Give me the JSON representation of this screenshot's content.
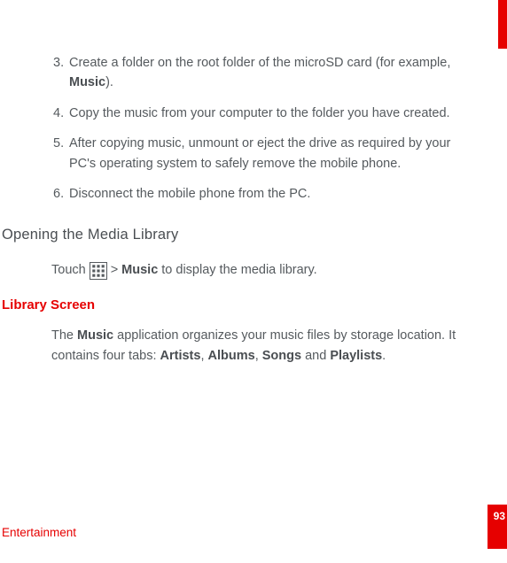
{
  "steps": [
    {
      "num": "3.",
      "pre": "Create a folder on the root folder of the microSD card (for example, ",
      "bold": "Music",
      "post": ")."
    },
    {
      "num": "4.",
      "pre": "Copy the music from your computer to the folder you have created.",
      "bold": "",
      "post": ""
    },
    {
      "num": "5.",
      "pre": "After copying music, unmount or eject the drive as required by your PC's operating system to safely remove the mobile phone.",
      "bold": "",
      "post": ""
    },
    {
      "num": "6.",
      "pre": "Disconnect the mobile phone from the PC.",
      "bold": "",
      "post": ""
    }
  ],
  "heading_opening": "Opening the Media Library",
  "touch_line": {
    "pre": "Touch",
    "icon_name": "apps-grid-icon",
    "gt": ">",
    "bold": "Music",
    "post": "to display the media library."
  },
  "library_heading": "Library Screen",
  "library_para": {
    "t1": "The ",
    "b1": "Music",
    "t2": " application organizes your music files by storage location. It contains four tabs: ",
    "b2": "Artists",
    "t3": ", ",
    "b3": "Albums",
    "t4": ", ",
    "b4": "Songs",
    "t5": " and ",
    "b5": "Playlists",
    "t6": "."
  },
  "footer_label": "Entertainment",
  "page_number": "93"
}
